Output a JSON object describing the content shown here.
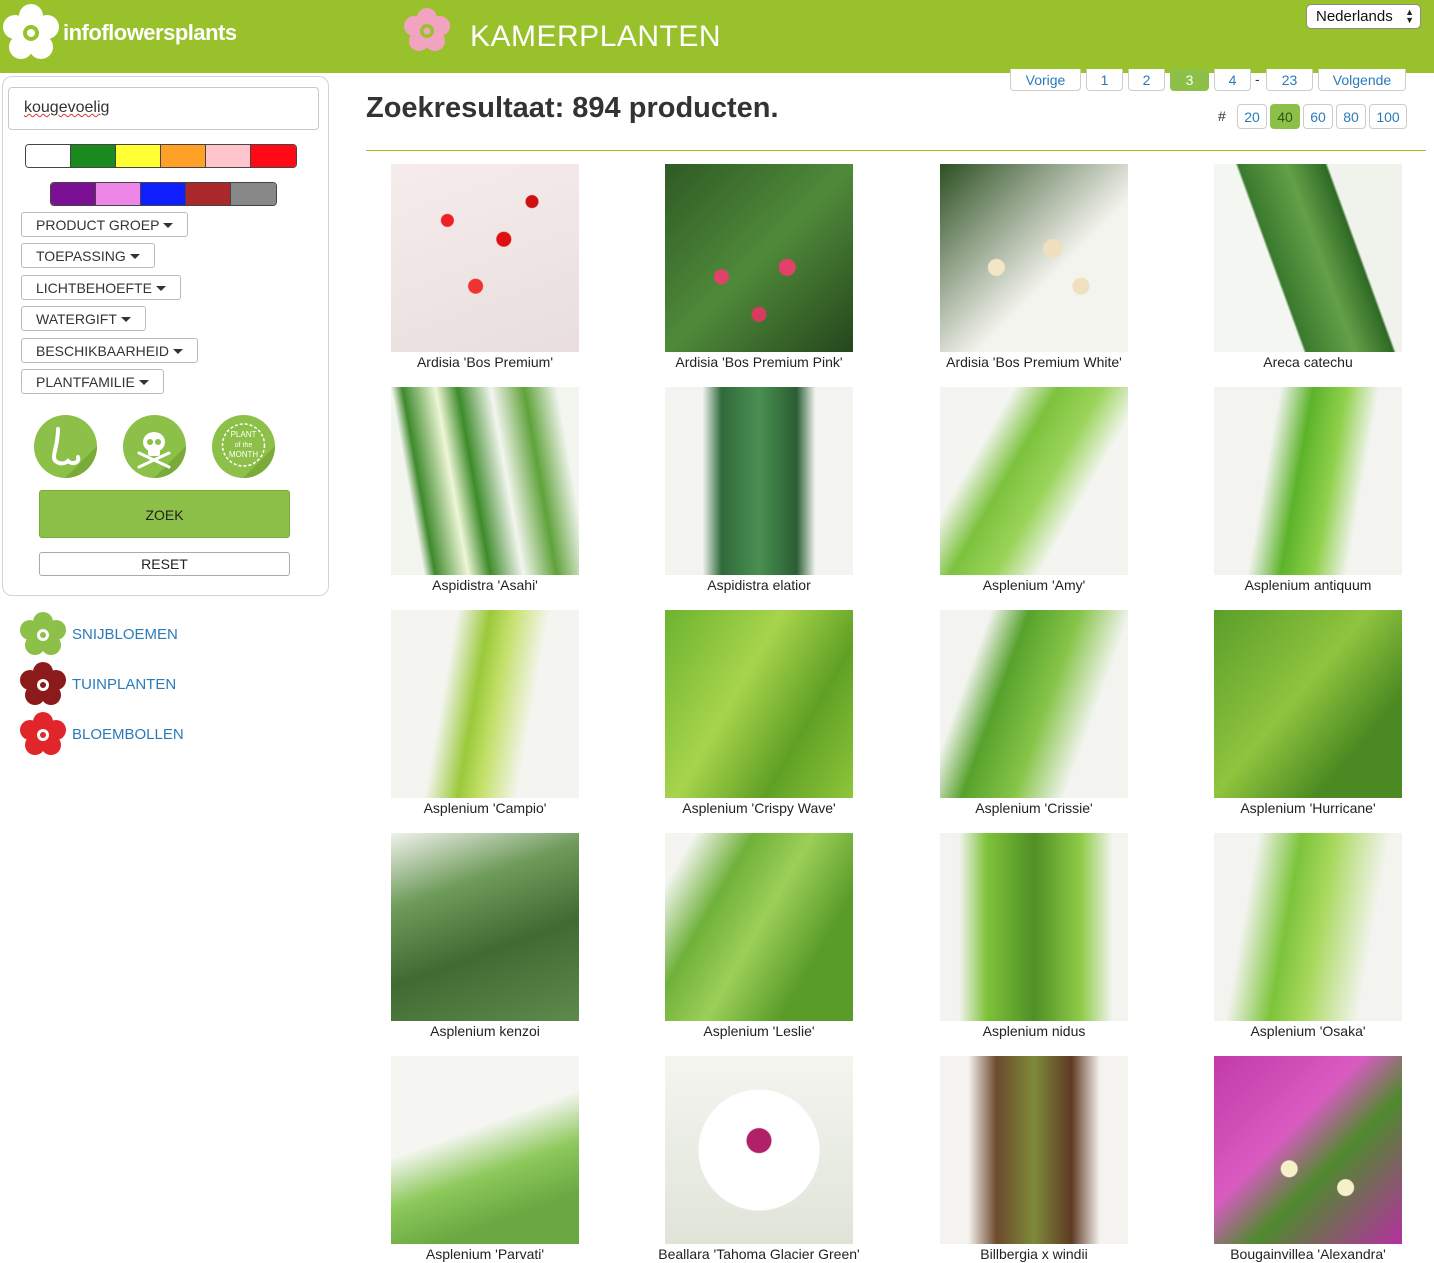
{
  "header": {
    "logo_text": "infoflowersplants",
    "category_title": "KAMERPLANTEN",
    "language": "Nederlands"
  },
  "sidebar": {
    "search_value": "kougevoelig",
    "colors_row1": [
      "#ffffff",
      "#1a8a1e",
      "#ffff33",
      "#ffa126",
      "#ffc4cc",
      "#ff0a14"
    ],
    "colors_row2": [
      "#7b1094",
      "#ee85e8",
      "#0f1fff",
      "#a8282c",
      "#888888"
    ],
    "filters": [
      "PRODUCT GROEP",
      "TOEPASSING",
      "LICHTBEHOEFTE",
      "WATERGIFT",
      "BESCHIKBAARHEID",
      "PLANTFAMILIE"
    ],
    "icon_buttons": [
      "nose-icon",
      "skull-icon",
      "plant-of-the-month-icon"
    ],
    "plant_of_month_text": [
      "PLANT",
      "of the",
      "MONTH"
    ],
    "search_button": "ZOEK",
    "reset_button": "RESET"
  },
  "categories": [
    {
      "label": "SNIJBLOEMEN",
      "color": "#8cc048"
    },
    {
      "label": "TUINPLANTEN",
      "color": "#8b1a1a"
    },
    {
      "label": "BLOEMBOLLEN",
      "color": "#e0262b"
    }
  ],
  "results": {
    "title": "Zoekresultaat: 894 producten."
  },
  "pagination": {
    "prev": "Vorige",
    "pages": [
      "1",
      "2",
      "3",
      "4"
    ],
    "current": "3",
    "separator": "-",
    "last": "23",
    "next": "Volgende"
  },
  "per_page": {
    "label": "#",
    "options": [
      "20",
      "40",
      "60",
      "80",
      "100"
    ],
    "selected": "40"
  },
  "products": [
    {
      "name": "Ardisia 'Bos Premium'"
    },
    {
      "name": "Ardisia 'Bos Premium Pink'"
    },
    {
      "name": "Ardisia 'Bos Premium White'"
    },
    {
      "name": "Areca catechu"
    },
    {
      "name": "Aspidistra 'Asahi'"
    },
    {
      "name": "Aspidistra elatior"
    },
    {
      "name": "Asplenium 'Amy'"
    },
    {
      "name": "Asplenium antiquum"
    },
    {
      "name": "Asplenium 'Campio'"
    },
    {
      "name": "Asplenium 'Crispy Wave'"
    },
    {
      "name": "Asplenium 'Crissie'"
    },
    {
      "name": "Asplenium 'Hurricane'"
    },
    {
      "name": "Asplenium kenzoi"
    },
    {
      "name": "Asplenium 'Leslie'"
    },
    {
      "name": "Asplenium nidus"
    },
    {
      "name": "Asplenium 'Osaka'"
    },
    {
      "name": "Asplenium 'Parvati'"
    },
    {
      "name": "Beallara 'Tahoma Glacier Green'"
    },
    {
      "name": "Billbergia x windii"
    },
    {
      "name": "Bougainvillea 'Alexandra'"
    }
  ]
}
